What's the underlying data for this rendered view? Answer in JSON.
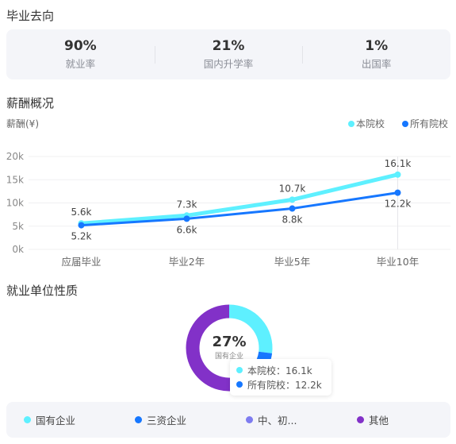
{
  "destination": {
    "title": "毕业去向",
    "stats": [
      {
        "value": "90%",
        "label": "就业率"
      },
      {
        "value": "21%",
        "label": "国内升学率"
      },
      {
        "value": "1%",
        "label": "出国率"
      }
    ]
  },
  "salary": {
    "title": "薪酬概况",
    "ylabel": "薪酬(¥)",
    "legend": [
      {
        "name": "本院校",
        "color": "#5ef0ff"
      },
      {
        "name": "所有院校",
        "color": "#1677ff"
      }
    ]
  },
  "chart_data": [
    {
      "type": "line",
      "title": "薪酬概况",
      "ylabel": "薪酬(¥)",
      "categories": [
        "应届毕业",
        "毕业2年",
        "毕业5年",
        "毕业10年"
      ],
      "yticks": [
        "0k",
        "5k",
        "10k",
        "15k",
        "20k"
      ],
      "ylim": [
        0,
        20
      ],
      "series": [
        {
          "name": "本院校",
          "color": "#5ef0ff",
          "values": [
            5.6,
            7.3,
            10.7,
            16.1
          ],
          "labels": [
            "5.6k",
            "7.3k",
            "10.7k",
            "16.1k"
          ]
        },
        {
          "name": "所有院校",
          "color": "#1677ff",
          "values": [
            5.2,
            6.6,
            8.8,
            12.2
          ],
          "labels": [
            "5.2k",
            "6.6k",
            "8.8k",
            "12.2k"
          ]
        }
      ],
      "legend": "top-right",
      "grid": true
    },
    {
      "type": "pie",
      "title": "就业单位性质",
      "center_value": "27%",
      "center_label": "国有企业",
      "slices": [
        {
          "name": "国有企业",
          "value": 27,
          "color": "#5ef0ff"
        },
        {
          "name": "三资企业",
          "value": 4,
          "color": "#1677ff"
        },
        {
          "name": "中、初...",
          "value": 0,
          "color": "#7e7cf0"
        },
        {
          "name": "其他",
          "value": 69,
          "color": "#8231c8"
        }
      ]
    }
  ],
  "employer": {
    "title": "就业单位性质",
    "center_value": "27%",
    "center_label": "国有企业",
    "tooltip": [
      {
        "text": "本院校：16.1k",
        "color": "#5ef0ff"
      },
      {
        "text": "所有院校：12.2k",
        "color": "#1677ff"
      }
    ],
    "legend": [
      {
        "name": "国有企业",
        "color": "#5ef0ff"
      },
      {
        "name": "三资企业",
        "color": "#1677ff"
      },
      {
        "name": "中、初...",
        "color": "#7e7cf0"
      },
      {
        "name": "其他",
        "color": "#8231c8"
      }
    ]
  }
}
